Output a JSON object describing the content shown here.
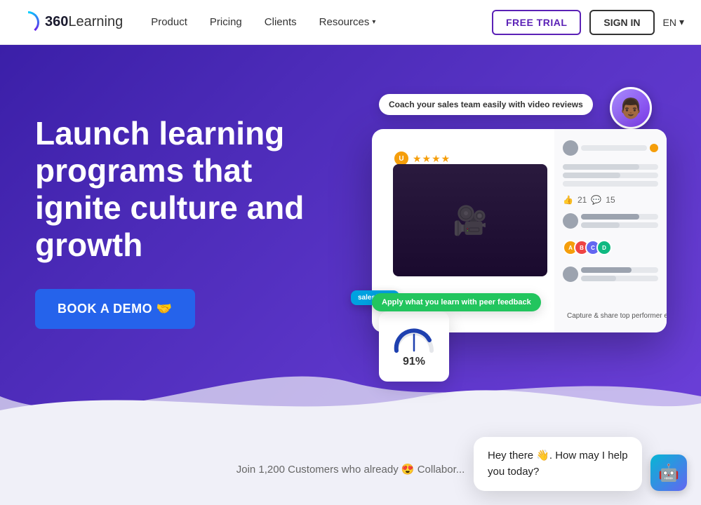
{
  "logo": {
    "name_bold": "360",
    "name_light": "Learning"
  },
  "nav": {
    "product": "Product",
    "pricing": "Pricing",
    "clients": "Clients",
    "resources": "Resources",
    "resources_chevron": "▾",
    "free_trial": "FREE TRIAL",
    "sign_in": "SIGN IN",
    "lang": "EN",
    "lang_chevron": "▾"
  },
  "hero": {
    "title": "Launch learning programs that ignite culture and growth",
    "cta_label": "BOOK A DEMO 🤝"
  },
  "mockup": {
    "bubble_top": "Coach your sales team easily with video reviews",
    "bubble_bottom": "Apply what you learn with peer feedback",
    "capture_text": "Capture & share top performer expertise",
    "salesforce_label": "salesforce",
    "gauge_value": "91%",
    "likes": "21",
    "comments": "15"
  },
  "bottom": {
    "join_text": "Join 1,200 Customers who already 😍 Collabor..."
  },
  "chat": {
    "message": "Hey there 👋. How may I help you today?",
    "bot_emoji": "🤖"
  }
}
